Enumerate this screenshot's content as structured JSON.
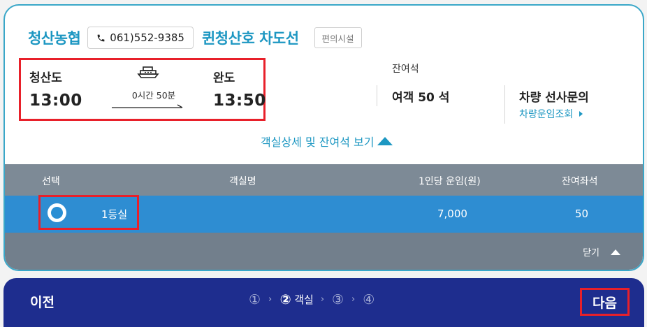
{
  "header": {
    "company": "청산농협",
    "phone": "061)552-9385",
    "ship_name": "퀸청산호 차도선",
    "facility_button": "편의시설"
  },
  "route": {
    "departure_port": "청산도",
    "departure_time": "13:00",
    "duration": "0시간 50분",
    "arrival_port": "완도",
    "arrival_time": "13:50"
  },
  "seats": {
    "title": "잔여석",
    "passenger": "여객 50 석"
  },
  "car": {
    "title": "차량 선사문의",
    "link": "차량운임조회"
  },
  "detail_toggle": "객실상세 및 잔여석 보기",
  "table": {
    "headers": [
      "선택",
      "객실명",
      "1인당 운임(원)",
      "잔여좌석"
    ],
    "rows": [
      {
        "room": "1등실",
        "fare": "7,000",
        "remaining": "50"
      }
    ],
    "close_label": "닫기"
  },
  "footer": {
    "prev_label": "이전",
    "steps": [
      "①",
      "②",
      "③",
      "④"
    ],
    "current_step_label": "객실",
    "next_label": "다음"
  },
  "colors": {
    "accent": "#1d97c2",
    "row_selected": "#2e8dd2",
    "table_header": "#7d8a96",
    "bottom_bar": "#1e2d8e",
    "highlight": "#e8202a"
  }
}
